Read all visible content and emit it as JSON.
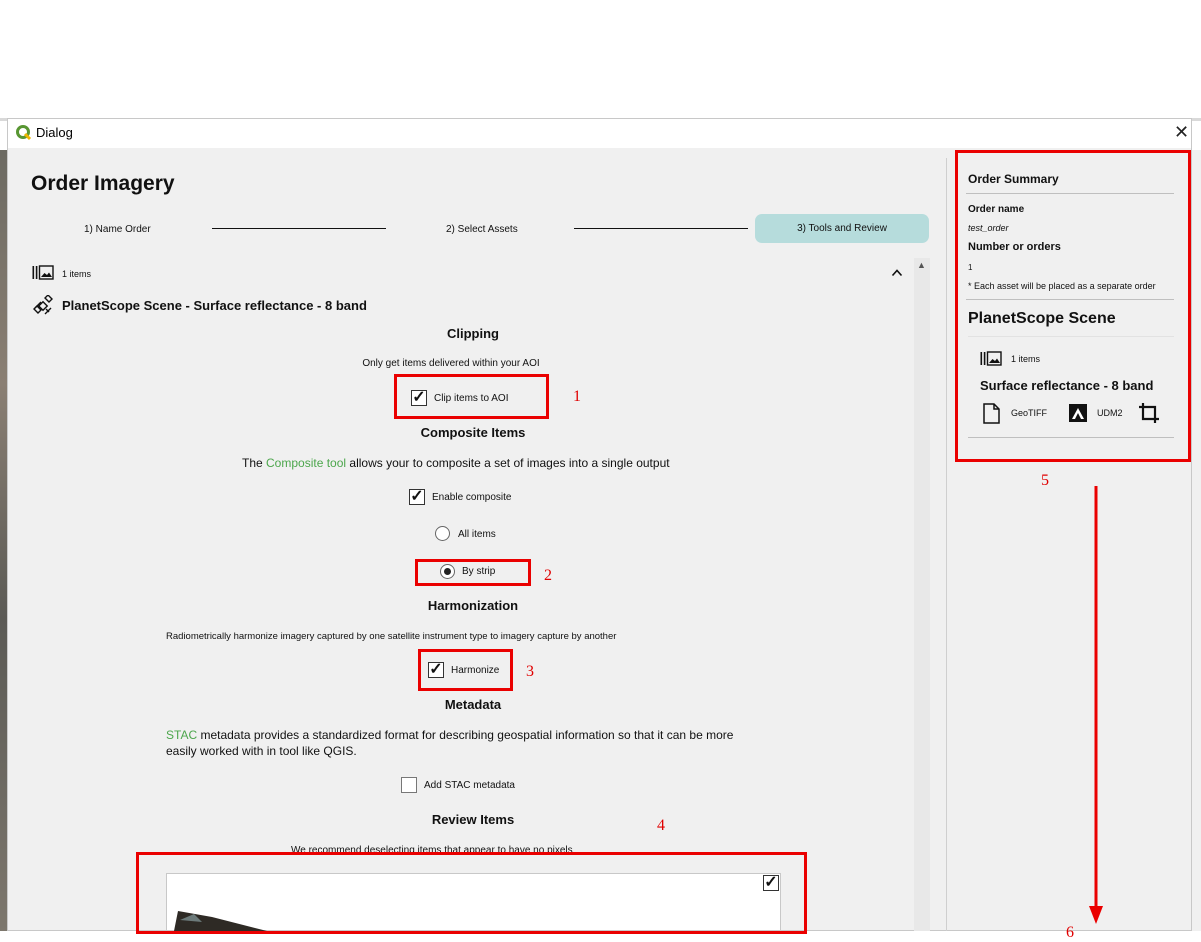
{
  "window": {
    "title": "Dialog",
    "close_glyph": "✕"
  },
  "page_title": "Order Imagery",
  "steps": [
    {
      "label": "1) Name Order"
    },
    {
      "label": "2) Select Assets"
    },
    {
      "label": "3) Tools and Review"
    }
  ],
  "item_bar": {
    "count_label": "1 items",
    "collapse_glyph": "^"
  },
  "product": {
    "name": "PlanetScope Scene - Surface reflectance - 8 band"
  },
  "clipping": {
    "title": "Clipping",
    "description": "Only get items delivered within your AOI",
    "checkbox_label": "Clip items to AOI",
    "checked": true
  },
  "composite": {
    "title": "Composite Items",
    "desc_prefix": "The ",
    "link": "Composite tool",
    "desc_suffix": " allows your to composite a set of images into a single output",
    "enable_label": "Enable composite",
    "enable_checked": true,
    "option_all": "All items",
    "option_strip": "By strip",
    "selected": "By strip"
  },
  "harmonization": {
    "title": "Harmonization",
    "description": "Radiometrically harmonize imagery captured by one satellite instrument type to imagery capture by another",
    "checkbox_label": "Harmonize",
    "checked": true
  },
  "metadata": {
    "title": "Metadata",
    "link": "STAC",
    "desc_line1": " metadata provides a standardized format for describing geospatial information so that it can be more",
    "desc_line2": "easily worked with in tool like QGIS.",
    "checkbox_label": "Add STAC metadata",
    "checked": false
  },
  "review": {
    "title": "Review Items",
    "description": "We recommend deselecting items that appear to have no pixels",
    "item_checked": true
  },
  "summary": {
    "title": "Order Summary",
    "order_name_label": "Order name",
    "order_name_value": "test_order",
    "orders_label": "Number or orders",
    "orders_value": "1",
    "note": "* Each asset will be placed as a separate order",
    "scene_title": "PlanetScope Scene",
    "items_label": "1 items",
    "product": "Surface reflectance - 8 band",
    "asset1": "GeoTIFF",
    "asset2": "UDM2"
  },
  "annotations": [
    "1",
    "2",
    "3",
    "4",
    "5",
    "6"
  ],
  "colors": {
    "accent_teal": "#b6dcdc",
    "link_green": "#4ca64c",
    "annotation_red": "#ea0000"
  },
  "icons": [
    "qgis-logo-icon",
    "close-icon",
    "items-stack-icon",
    "satellite-icon",
    "chevron-up-icon",
    "file-icon",
    "udm-icon",
    "crop-icon"
  ]
}
